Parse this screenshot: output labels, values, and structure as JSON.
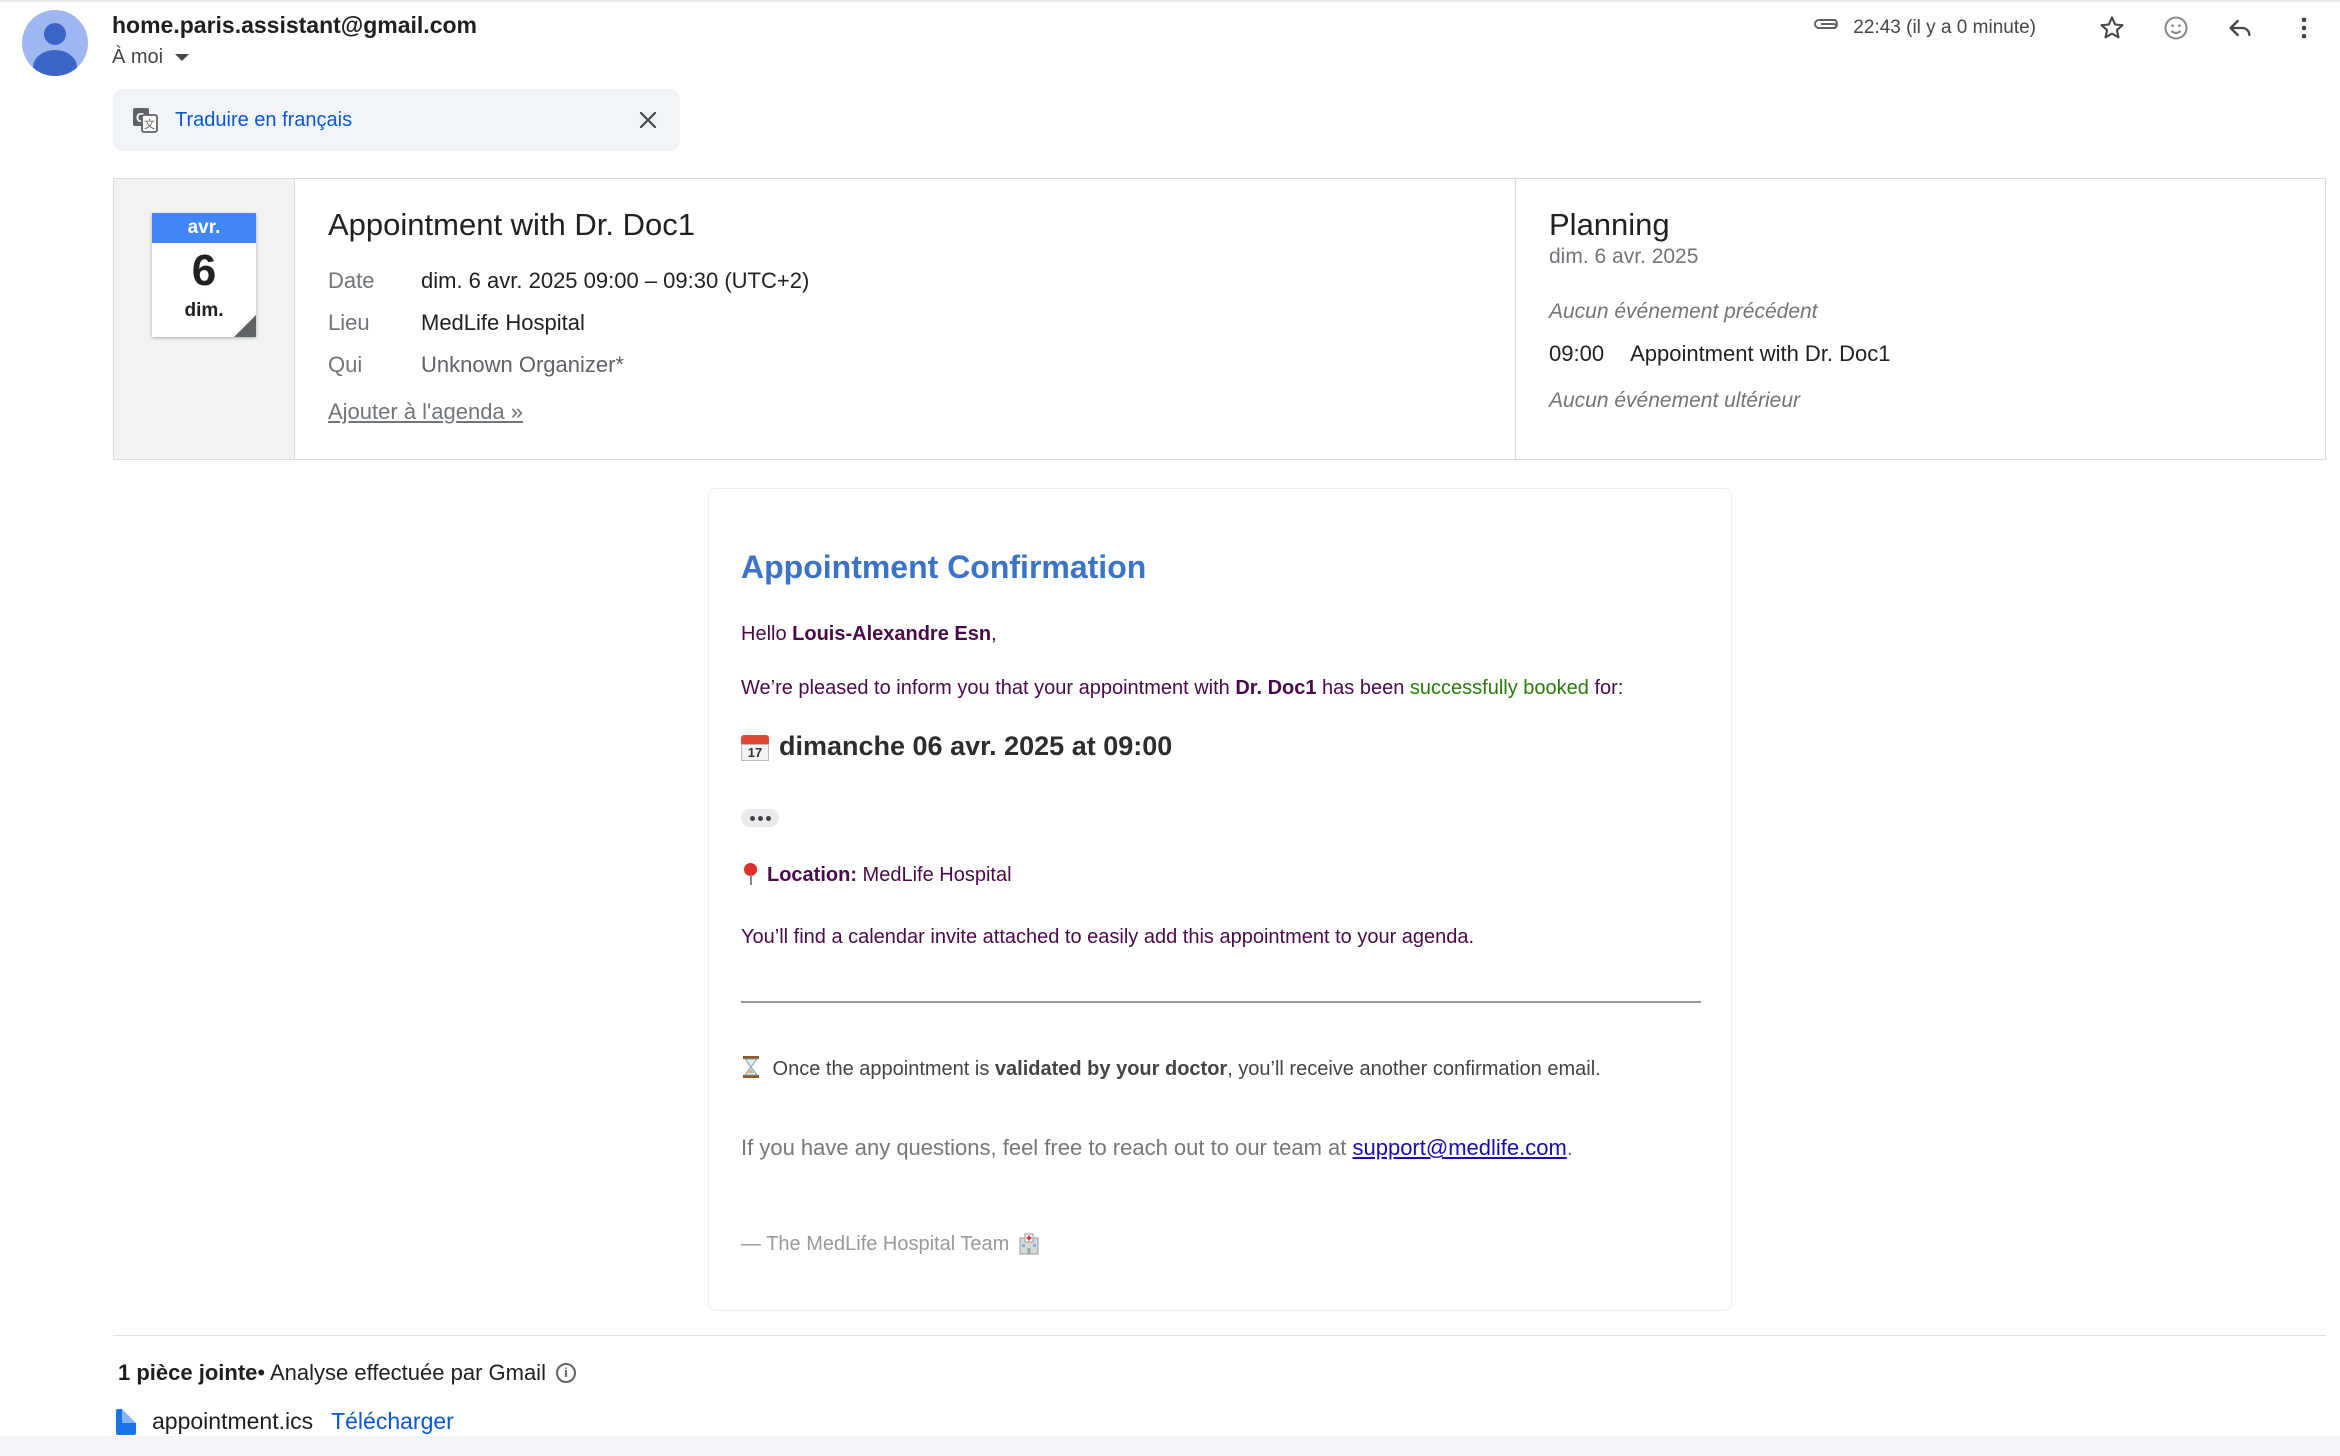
{
  "header": {
    "sender": "home.paris.assistant@gmail.com",
    "recipient": "À moi",
    "time": "22:43 (il y a 0 minute)"
  },
  "translate": {
    "label": "Traduire en français"
  },
  "calendar_card": {
    "badge": {
      "month": "avr.",
      "day": "6",
      "weekday": "dim."
    },
    "event_title": "Appointment with Dr. Doc1",
    "rows": [
      {
        "key": "Date",
        "value": "dim. 6 avr. 2025 09:00 – 09:30 (UTC+2)"
      },
      {
        "key": "Lieu",
        "value": "MedLife Hospital"
      },
      {
        "key": "Qui",
        "value": "Unknown Organizer*"
      }
    ],
    "add_link": "Ajouter à l'agenda »",
    "planning": {
      "title": "Planning",
      "date": "dim. 6 avr. 2025",
      "no_previous": "Aucun événement précédent",
      "event_time": "09:00",
      "event_title": "Appointment with Dr. Doc1",
      "no_next": "Aucun événement ultérieur"
    }
  },
  "email": {
    "title": "Appointment Confirmation",
    "hello": "Hello ",
    "name": "Louis-Alexandre Esn",
    "comma": ",",
    "p1_a": "We’re pleased to inform you that your appointment with ",
    "doctor": "Dr. Doc1",
    "p1_b": " has been ",
    "p1_green": "successfully booked",
    "p1_c": " for:",
    "calendar_emoji_day": "17",
    "date_line": "dimanche 06 avr. 2025 at 09:00",
    "location_label": "Location:",
    "location_value": " MedLife Hospital",
    "p_invite": "You’ll find a calendar invite attached to easily add this appointment to your agenda.",
    "validate_a": " Once the appointment is ",
    "validate_b": "validated by your doctor",
    "validate_c": ", you’ll receive another confirmation email.",
    "questions_a": "If you have any questions, feel free to reach out to our team at ",
    "support_email": "support@medlife.com",
    "questions_b": ".",
    "signature": "— The MedLife Hospital Team"
  },
  "attachments": {
    "count_label": "1 pièce jointe",
    "scan_label": " • Analyse effectuée par Gmail",
    "file_name": "appointment.ics",
    "download": "Télécharger"
  },
  "colors": {
    "accent_link": "#0b57d0",
    "email_title": "#3b73c6",
    "email_text": "#4a0a4a",
    "success_green": "#2b7a0b",
    "calendar_blue": "#4285f4"
  }
}
